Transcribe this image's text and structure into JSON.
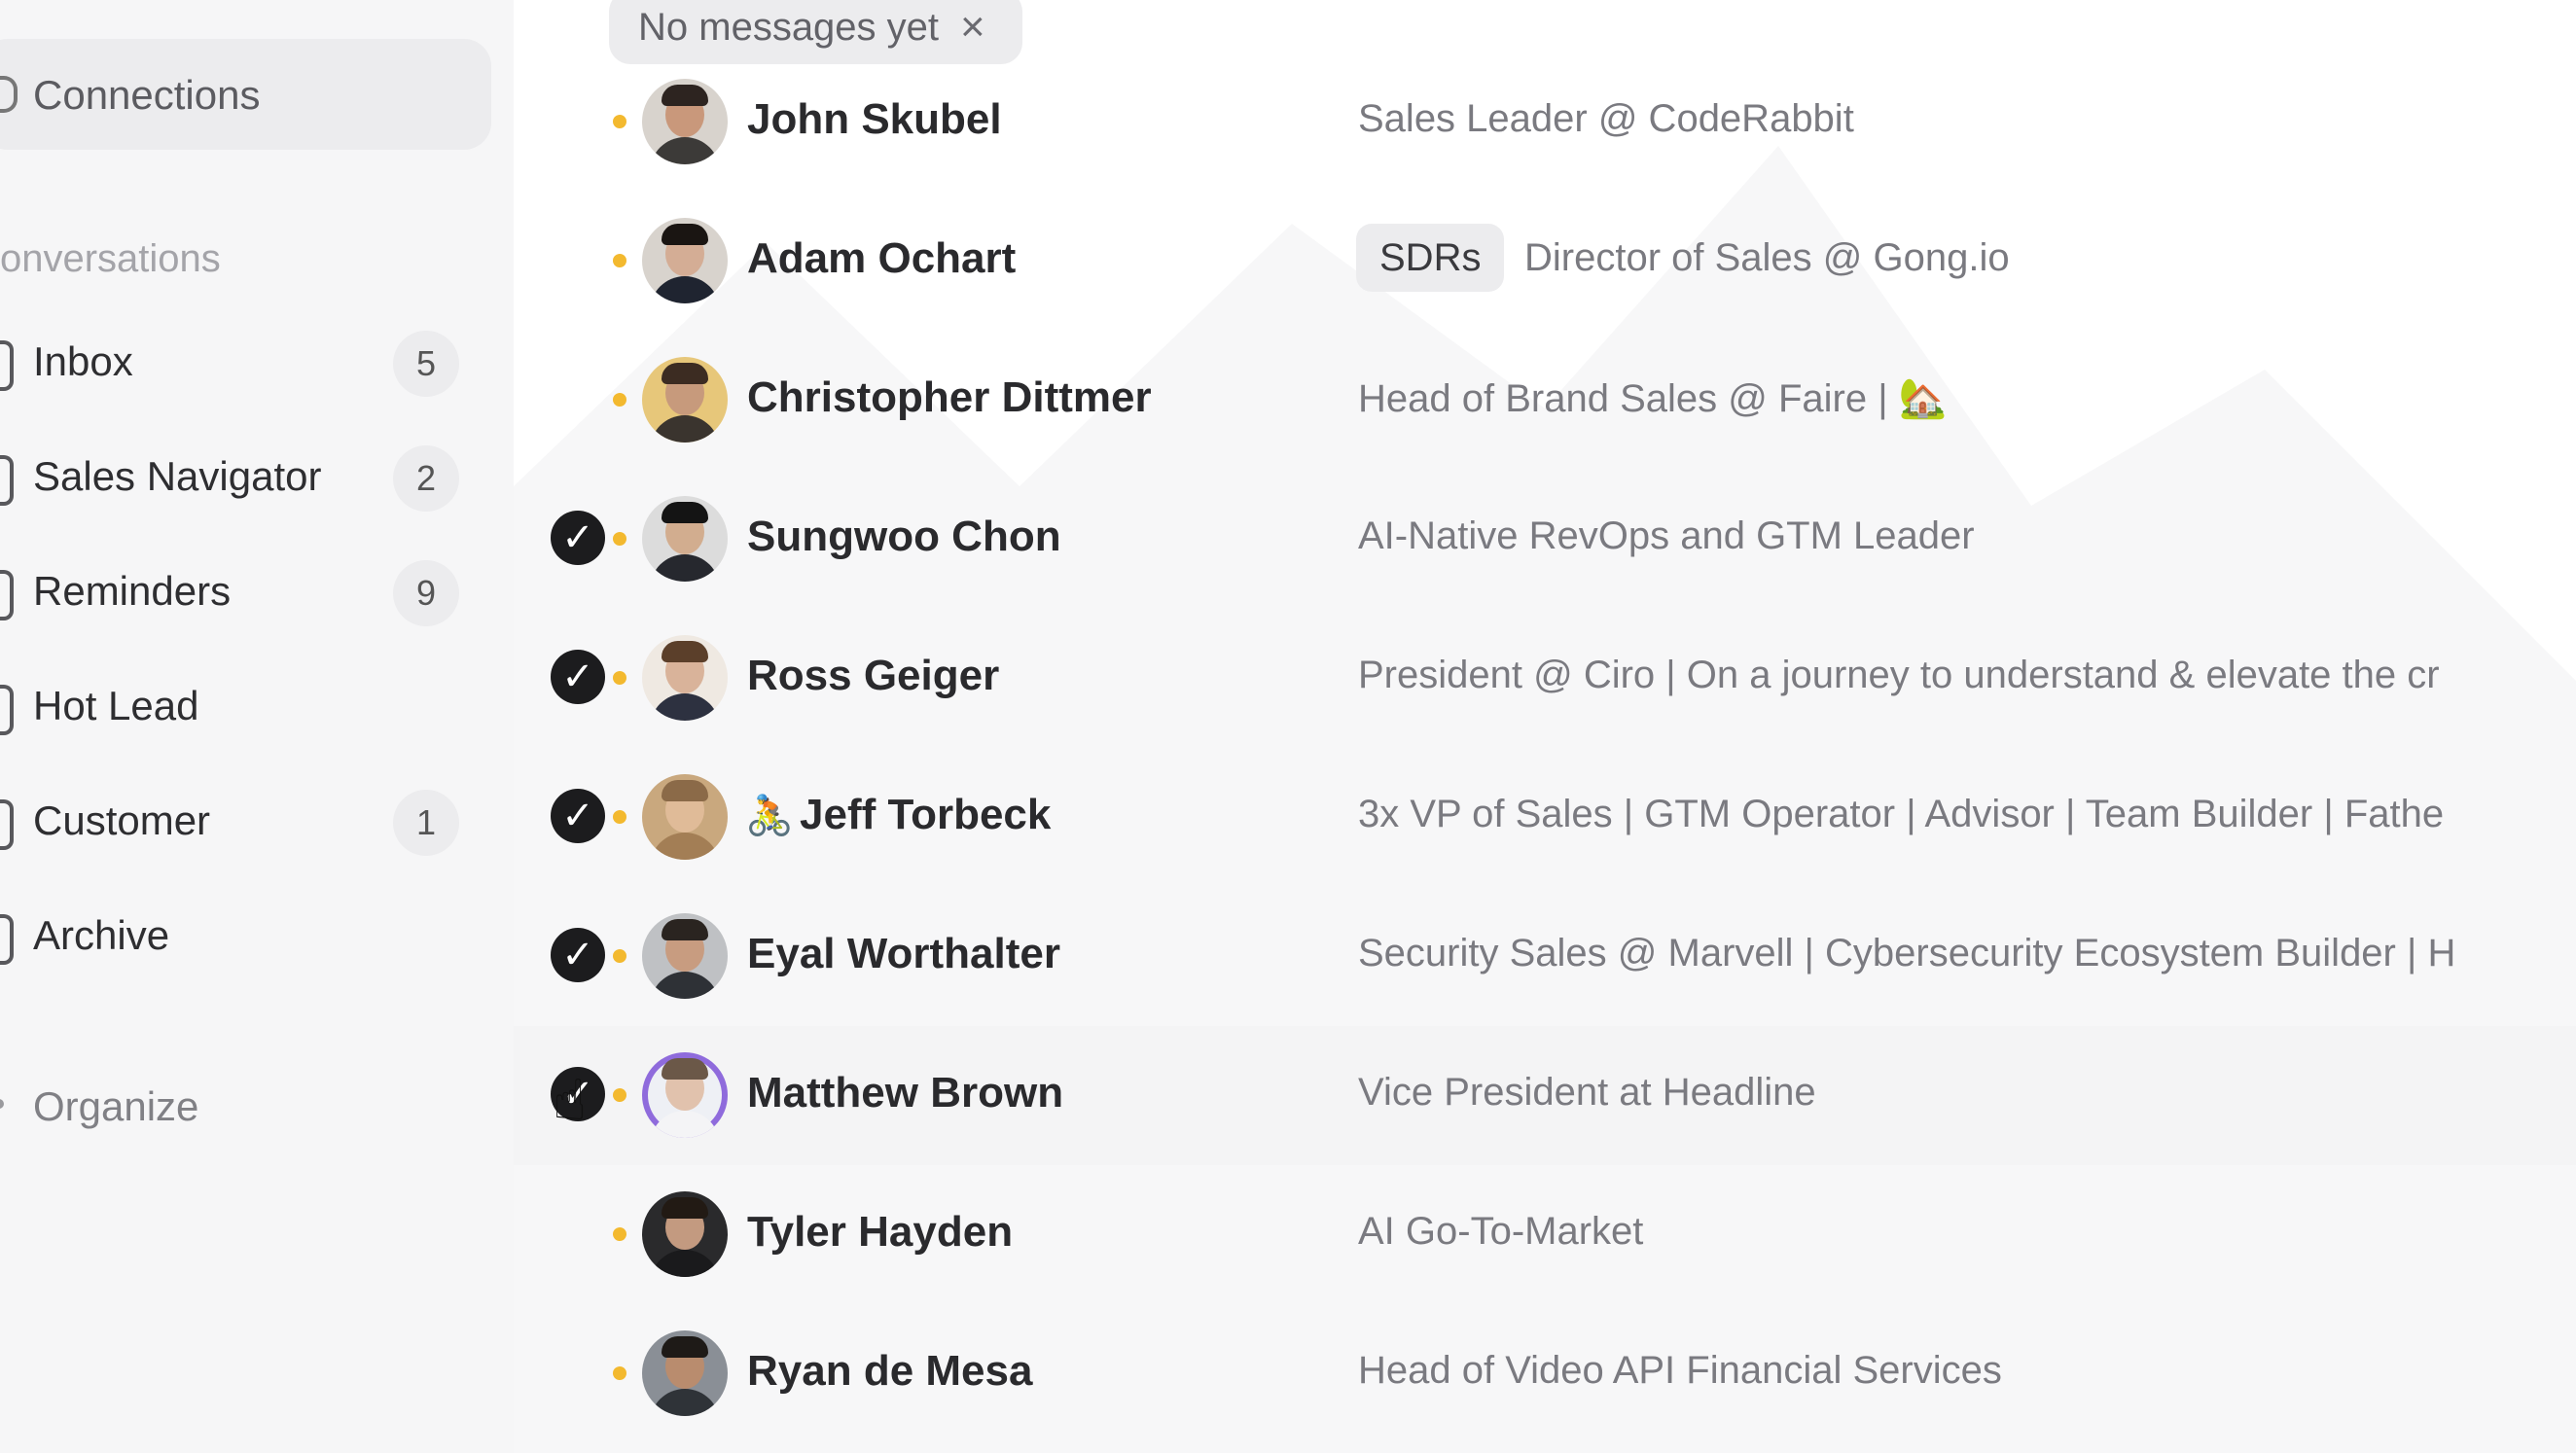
{
  "sidebar": {
    "connections_label": "Connections",
    "section_label": "onversations",
    "items": [
      {
        "label": "Inbox",
        "count": "5"
      },
      {
        "label": "Sales Navigator",
        "count": "2"
      },
      {
        "label": "Reminders",
        "count": "9"
      },
      {
        "label": "Hot Lead",
        "count": ""
      },
      {
        "label": "Customer",
        "count": "1"
      },
      {
        "label": "Archive",
        "count": ""
      }
    ],
    "organize_label": "Organize"
  },
  "filter": {
    "chip_label": "No messages yet",
    "chip_close": "×"
  },
  "contacts": [
    {
      "name": "John Skubel",
      "headline": "Sales Leader @ CodeRabbit",
      "tag": "",
      "checked": false
    },
    {
      "name": "Adam Ochart",
      "headline": "Director of Sales @ Gong.io",
      "tag": "SDRs",
      "checked": false
    },
    {
      "name": "Christopher Dittmer",
      "headline": "Head of Brand Sales @ Faire | 🏡",
      "tag": "",
      "checked": false
    },
    {
      "name": "Sungwoo Chon",
      "headline": "AI-Native RevOps and GTM Leader",
      "tag": "",
      "checked": true
    },
    {
      "name": "Ross Geiger",
      "headline": "President @ Ciro | On a journey to understand & elevate the cr",
      "tag": "",
      "checked": true
    },
    {
      "name": "Jeff Torbeck",
      "name_icon": "🚴",
      "headline": "3x VP of Sales | GTM Operator | Advisor | Team Builder | Fathe",
      "tag": "",
      "checked": true
    },
    {
      "name": "Eyal Worthalter",
      "headline": "Security Sales @ Marvell | Cybersecurity Ecosystem Builder | H",
      "tag": "",
      "checked": true
    },
    {
      "name": "Matthew Brown",
      "headline": "Vice President at Headline",
      "tag": "",
      "checked": true
    },
    {
      "name": "Tyler Hayden",
      "headline": "AI Go-To-Market",
      "tag": "",
      "checked": false
    },
    {
      "name": "Ryan de Mesa",
      "headline": "Head of Video API Financial Services",
      "tag": "",
      "checked": false
    }
  ],
  "glyphs": {
    "check": "✓",
    "cursor": "☝"
  },
  "colors": {
    "presence_dot": "#f3b92f",
    "checkbox_fill": "#1c1c1e",
    "ring_accent": "#8f6bdc"
  }
}
